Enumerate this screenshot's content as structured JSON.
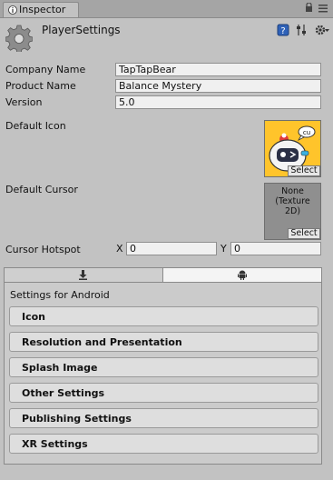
{
  "tab": {
    "label": "Inspector"
  },
  "header": {
    "title": "PlayerSettings"
  },
  "fields": [
    {
      "label": "Company Name",
      "value": "TapTapBear"
    },
    {
      "label": "Product Name",
      "value": "Balance Mystery"
    },
    {
      "label": "Version",
      "value": "5.0"
    }
  ],
  "default_icon": {
    "label": "Default Icon",
    "select": "Select",
    "speech": "cu"
  },
  "default_cursor": {
    "label": "Default Cursor",
    "line1": "None",
    "line2": "(Texture",
    "line3": "2D)",
    "select": "Select"
  },
  "cursor_hotspot": {
    "label": "Cursor Hotspot",
    "x_label": "X",
    "x_value": "0",
    "y_label": "Y",
    "y_value": "0"
  },
  "platform": {
    "tabs": [
      {
        "icon": "download-icon"
      },
      {
        "icon": "android-icon"
      }
    ],
    "title": "Settings for Android",
    "sections": [
      {
        "label": "Icon"
      },
      {
        "label": "Resolution and Presentation"
      },
      {
        "label": "Splash Image"
      },
      {
        "label": "Other Settings"
      },
      {
        "label": "Publishing Settings"
      },
      {
        "label": "XR Settings"
      }
    ]
  }
}
